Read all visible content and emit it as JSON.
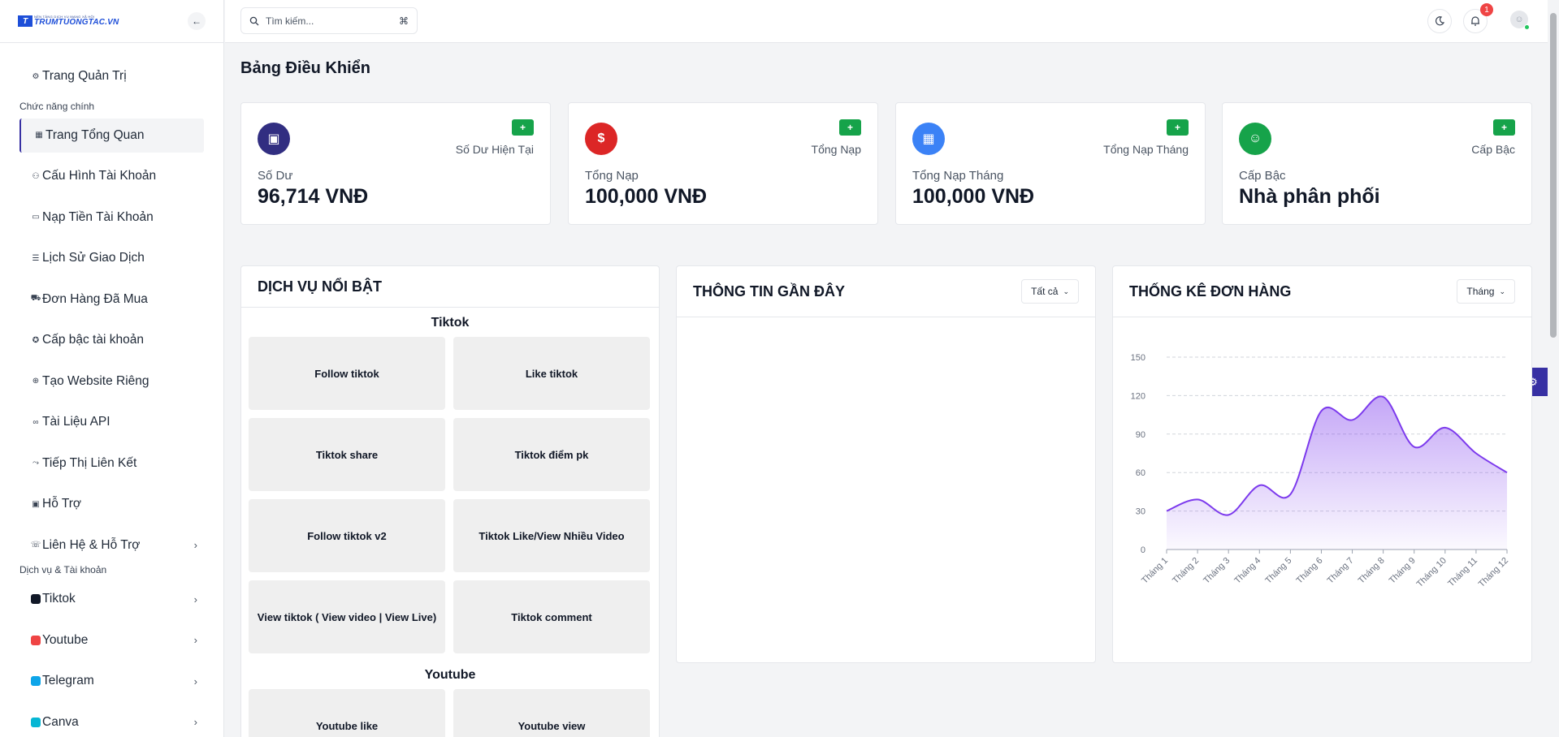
{
  "brand": {
    "name": "TRUMTUONGTAC.VN",
    "tagline": "NỀN TẢNG DỊCH VỤ MẠNG XÃ HỘI"
  },
  "sidebar": {
    "admin": {
      "label": "Trang Quản Trị",
      "icon": "settings-icon"
    },
    "main_section": "Chức năng chính",
    "items": [
      {
        "label": "Trang Tổng Quan",
        "icon": "dashboard-icon",
        "active": true
      },
      {
        "label": "Cấu Hình Tài Khoản",
        "icon": "user-gear-icon"
      },
      {
        "label": "Nạp Tiền Tài Khoản",
        "icon": "card-icon"
      },
      {
        "label": "Lịch Sử Giao Dịch",
        "icon": "list-icon"
      },
      {
        "label": "Đơn Hàng Đã Mua",
        "icon": "cart-icon"
      },
      {
        "label": "Cấp bậc tài khoản",
        "icon": "medal-icon"
      },
      {
        "label": "Tạo Website Riêng",
        "icon": "globe-icon"
      },
      {
        "label": "Tài Liệu API",
        "icon": "api-icon"
      },
      {
        "label": "Tiếp Thị Liên Kết",
        "icon": "share-icon"
      },
      {
        "label": "Hỗ Trợ",
        "icon": "ticket-icon"
      },
      {
        "label": "Liên Hệ & Hỗ Trợ",
        "icon": "contact-icon"
      }
    ],
    "services_section": "Dịch vụ & Tài khoản",
    "services": [
      {
        "label": "Tiktok",
        "icon": "tiktok-icon",
        "color": "#111827"
      },
      {
        "label": "Youtube",
        "icon": "youtube-icon",
        "color": "#ef4444"
      },
      {
        "label": "Telegram",
        "icon": "telegram-icon",
        "color": "#0ea5e9"
      },
      {
        "label": "Canva",
        "icon": "canva-icon",
        "color": "#06b6d4"
      }
    ]
  },
  "header": {
    "search_placeholder": "Tìm kiếm...",
    "notification_count": "1"
  },
  "page_title": "Bảng Điều Khiển",
  "stats": [
    {
      "sub": "Số Dư Hiện Tại",
      "label": "Số Dư",
      "value": "96,714 VNĐ",
      "icon": "wallet-icon",
      "color": "#312e81"
    },
    {
      "sub": "Tổng Nạp",
      "label": "Tổng Nạp",
      "value": "100,000 VNĐ",
      "icon": "dollar-icon",
      "color": "#dc2626"
    },
    {
      "sub": "Tổng Nạp Tháng",
      "label": "Tổng Nạp Tháng",
      "value": "100,000 VNĐ",
      "icon": "calendar-icon",
      "color": "#3b82f6"
    },
    {
      "sub": "Cấp Bậc",
      "label": "Cấp Bậc",
      "value": "Nhà phân phối",
      "icon": "user-icon",
      "color": "#16a34a"
    }
  ],
  "plus_label": "+",
  "featured": {
    "title": "DỊCH VỤ NỔI BẬT",
    "groups": [
      {
        "name": "Tiktok",
        "items": [
          "Follow tiktok",
          "Like tiktok",
          "Tiktok share",
          "Tiktok điểm pk",
          "Follow tiktok v2",
          "Tiktok Like/View Nhiều Video",
          "View tiktok ( View video | View Live)",
          "Tiktok comment"
        ]
      },
      {
        "name": "Youtube",
        "items": [
          "Youtube like",
          "Youtube view"
        ]
      }
    ]
  },
  "recent": {
    "title": "THÔNG TIN GẦN ĐÂY",
    "filter": "Tất cả"
  },
  "orders": {
    "title": "THỐNG KÊ ĐƠN HÀNG",
    "filter": "Tháng"
  },
  "chart_data": {
    "type": "area",
    "title": "THỐNG KÊ ĐƠN HÀNG",
    "categories": [
      "Tháng 1",
      "Tháng 2",
      "Tháng 3",
      "Tháng 4",
      "Tháng 5",
      "Tháng 6",
      "Tháng 7",
      "Tháng 8",
      "Tháng 9",
      "Tháng 10",
      "Tháng 11",
      "Tháng 12"
    ],
    "values": [
      30,
      39,
      27,
      50,
      43,
      108,
      101,
      119,
      80,
      95,
      75,
      60
    ],
    "ylim": [
      0,
      150
    ],
    "yticks": [
      0,
      30,
      60,
      90,
      120,
      150
    ],
    "grid": true,
    "color": "#7c3aed"
  }
}
